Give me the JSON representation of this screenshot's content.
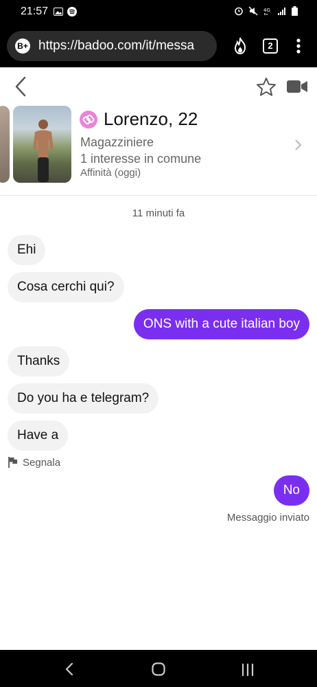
{
  "status_bar": {
    "time": "21:57",
    "left_icons": [
      "image-icon",
      "spotify-icon"
    ],
    "right_icons": [
      "alarm-icon",
      "mute-icon",
      "4g-icon",
      "signal-icon",
      "battery-icon"
    ]
  },
  "browser": {
    "badge": "B+",
    "url": "https://badoo.com/it/messa",
    "tab_count": "2"
  },
  "profile": {
    "name": "Lorenzo, 22",
    "job": "Magazziniere",
    "common": "1 interesse in comune",
    "affinity": "Affinità (oggi)"
  },
  "chat": {
    "timestamp": "11 minuti fa",
    "messages": [
      {
        "side": "in",
        "text": "Ehi"
      },
      {
        "side": "in",
        "text": "Cosa cerchi qui?"
      },
      {
        "side": "out",
        "text": "ONS with a cute italian boy"
      },
      {
        "side": "in",
        "text": "Thanks"
      },
      {
        "side": "in",
        "text": "Do you ha e telegram?"
      },
      {
        "side": "in",
        "text": "Have a"
      },
      {
        "side": "out",
        "text": "No"
      }
    ],
    "report_label": "Segnala",
    "sent_status": "Messaggio inviato"
  },
  "colors": {
    "accent": "#7a2ff0",
    "incoming_bubble": "#f2f2f2",
    "match_badge": "#e985d8"
  }
}
